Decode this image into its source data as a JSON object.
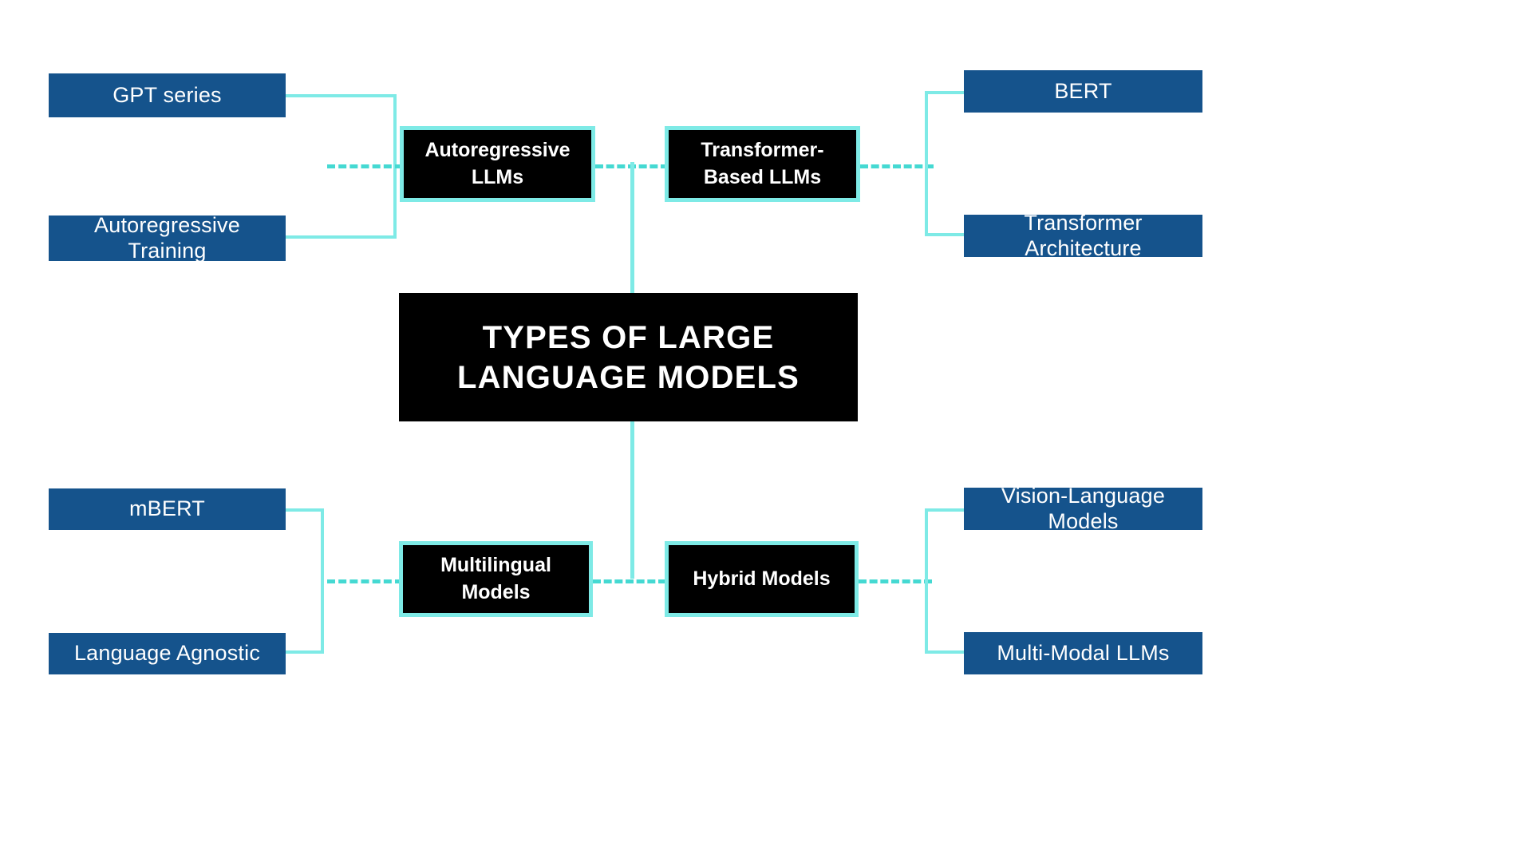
{
  "diagram": {
    "type": "mind-map",
    "title": "Types of Large Language Models",
    "colors": {
      "leaf_fill": "#15538c",
      "leaf_text": "#ffffff",
      "category_fill": "#000000",
      "category_border": "#7eeae6",
      "connector": "#7eeae6",
      "connector_dashed": "#45d9d2",
      "background": "#ffffff",
      "center_fill": "#000000",
      "center_text": "#ffffff"
    }
  },
  "center": {
    "label": "TYPES OF LARGE LANGUAGE MODELS"
  },
  "branches": [
    {
      "id": "autoregressive-llms",
      "label": "Autoregressive LLMs",
      "side": "left",
      "row": "top",
      "leaves": [
        {
          "label": "GPT series"
        },
        {
          "label": "Autoregressive Training"
        }
      ]
    },
    {
      "id": "transformer-based-llms",
      "label": "Transformer-Based LLMs",
      "side": "right",
      "row": "top",
      "leaves": [
        {
          "label": "BERT"
        },
        {
          "label": "Transformer Architecture"
        }
      ]
    },
    {
      "id": "multilingual-models",
      "label": "Multilingual Models",
      "side": "left",
      "row": "bottom",
      "leaves": [
        {
          "label": "mBERT"
        },
        {
          "label": "Language Agnostic"
        }
      ]
    },
    {
      "id": "hybrid-models",
      "label": "Hybrid Models",
      "side": "right",
      "row": "bottom",
      "leaves": [
        {
          "label": "Vision-Language Models"
        },
        {
          "label": "Multi-Modal LLMs"
        }
      ]
    }
  ]
}
